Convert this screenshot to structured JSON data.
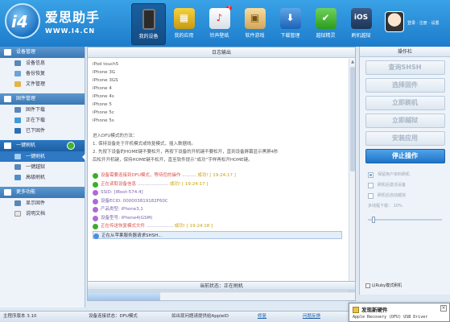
{
  "header": {
    "brand_name": "爱思助手",
    "brand_url": "WWW.I4.CN",
    "logo_text": "i4",
    "nav": [
      {
        "label": "我的设备",
        "icon": "phone-icon"
      },
      {
        "label": "我的应用",
        "icon": "apps-icon"
      },
      {
        "label": "铃声壁纸",
        "icon": "ringtone-icon",
        "badge": "2"
      },
      {
        "label": "软件游戏",
        "icon": "box-icon"
      },
      {
        "label": "下载管理",
        "icon": "download-icon"
      },
      {
        "label": "越狱精灵",
        "icon": "lock-icon"
      },
      {
        "label": "刷机越狱",
        "icon": "ios-icon"
      }
    ],
    "user_links": "登录 · 注册 · 设置"
  },
  "sidebar": {
    "sections": [
      {
        "title": "设备管理",
        "items": [
          "设备信息",
          "备份恢复",
          "文件管理"
        ]
      },
      {
        "title": "固件管理",
        "items": [
          "固件下载",
          "正在下载",
          "已下固件"
        ]
      },
      {
        "title": "一键刷机",
        "items": [
          "一键刷机",
          "一键越狱",
          "高级刷机"
        ]
      },
      {
        "title": "更多功能",
        "items": [
          "显示固件",
          "说明文档"
        ]
      }
    ]
  },
  "main": {
    "panel_title": "日志输出",
    "log_lines": [
      "iPod touch5",
      "iPhone 3G",
      "iPhone 3GS",
      "iPhone 4",
      "iPhone 4s",
      "iPhone 5",
      "iPhone 5c",
      "iPhone 5s"
    ],
    "dfu_title": "进入DFU模式的方法：",
    "dfu_steps": [
      "1. 保持设备处于开机模式或恢复模式，插入数据线。",
      "2. 先按下设备的HOME键不要松开，再按下设备的开机键不要松开，直到设备屏幕显示黑屏4秒",
      "   后松开开机键，保持HOME键不松开，直至软件提示“成功”字样再松开HOME键。"
    ],
    "steps": [
      {
        "text": "设备需要连接到DFU模式，等待您的操作",
        "result": "成功!",
        "time": "[ 19:24:17 ]"
      },
      {
        "text": "正在读取设备信息",
        "result": "成功!",
        "time": "[ 19:24:17 ]"
      },
      {
        "text": "SSID: [iBoot-574.4]",
        "result": "",
        "time": ""
      },
      {
        "text": "设备ECID: 000003819182F60C",
        "result": "",
        "time": ""
      },
      {
        "text": "产品类型: iPhone3,1",
        "result": "",
        "time": ""
      },
      {
        "text": "设备型号: iPhone4(GSM)",
        "result": "",
        "time": ""
      },
      {
        "text": "正在传送恢复模式文件",
        "result": "成功!",
        "time": "[ 19:24:18 ]"
      },
      {
        "text": "正在从苹果服务器请求SHSH...",
        "result": "",
        "time": ""
      }
    ],
    "status_text": "当前状态：正在刷机",
    "progress": 0.27
  },
  "right": {
    "panel_title": "操作栏",
    "buttons": [
      "查询SHSH",
      "选择固件",
      "立即刷机",
      "立即越狱",
      "安装应用",
      "停止操作"
    ],
    "options": [
      {
        "label": "保留用户资料刷机",
        "checked": true
      },
      {
        "label": "刷机后激活设备",
        "checked": false
      },
      {
        "label": "刷机后自动越狱",
        "checked": false
      }
    ],
    "slider_label": "多线程下载： 10%",
    "slider_value": 0.05,
    "auto_label": "以Ruby模式刷机"
  },
  "footer": {
    "version": "主程序版本 3.10",
    "device_state": "设备连接状态：DFU模式",
    "hint": "如出现问题请提供给AppleID",
    "link1": "修复",
    "link2": "问题反馈"
  },
  "toast": {
    "title": "发现新硬件",
    "message": "Apple Recovery (DFU) USB Driver"
  },
  "colors": {
    "header_blue": "#1d7ccb",
    "primary_button": "#1f73c8",
    "success_green": "#3cad2a"
  }
}
